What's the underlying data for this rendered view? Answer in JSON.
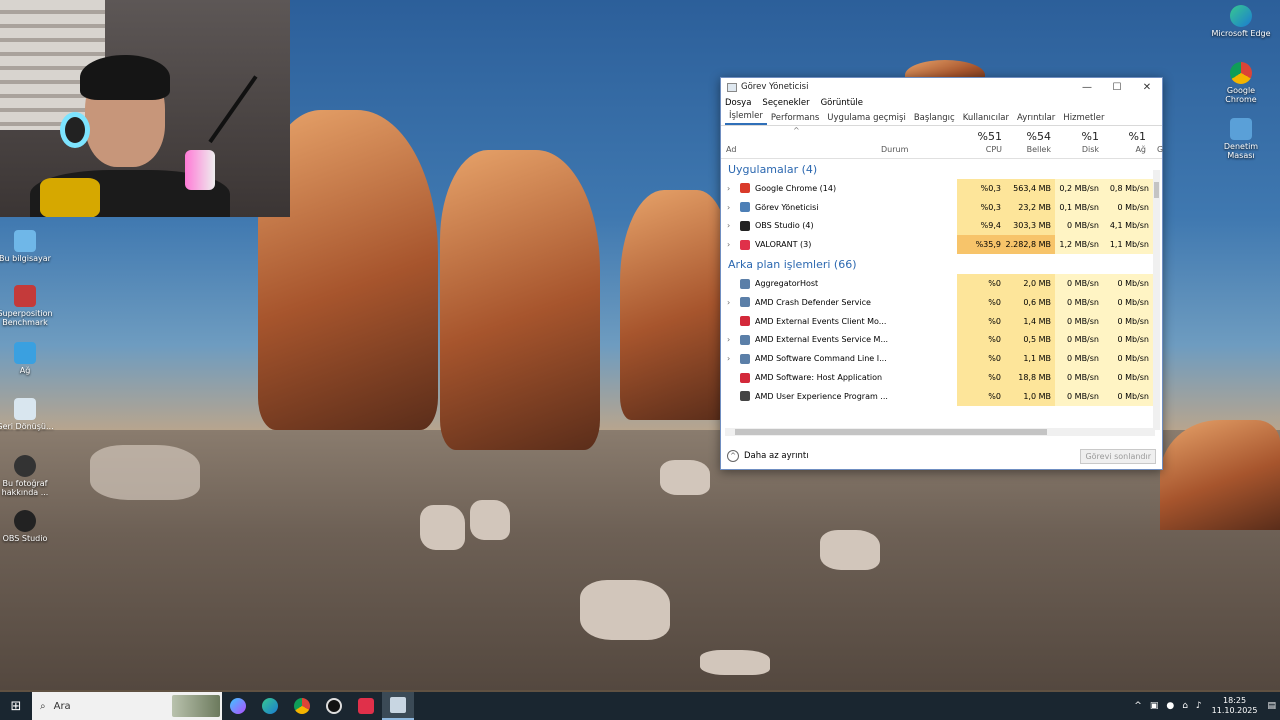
{
  "desktop_icons": [
    {
      "label": "Bu bilgisayar"
    },
    {
      "label": "Superposition Benchmark"
    },
    {
      "label": "Ağ"
    },
    {
      "label": "Geri Dönüşü..."
    },
    {
      "label": "Bu fotoğraf hakkında ..."
    },
    {
      "label": "OBS Studio"
    }
  ],
  "desktop_icons_right": [
    {
      "label": "Microsoft Edge"
    },
    {
      "label": "Google Chrome"
    },
    {
      "label": "Denetim Masası"
    }
  ],
  "window": {
    "title": "Görev Yöneticisi",
    "minimize": "—",
    "maximize": "☐",
    "close": "✕"
  },
  "menu": [
    "Dosya",
    "Seçenekler",
    "Görüntüle"
  ],
  "tabs": [
    "İşlemler",
    "Performans",
    "Uygulama geçmişi",
    "Başlangıç",
    "Kullanıcılar",
    "Ayrıntılar",
    "Hizmetler"
  ],
  "columns": {
    "name": "Ad",
    "status": "Durum",
    "cpu": {
      "pct": "%51",
      "label": "CPU"
    },
    "memory": {
      "pct": "%54",
      "label": "Bellek"
    },
    "disk": {
      "pct": "%1",
      "label": "Disk"
    },
    "network": {
      "pct": "%1",
      "label": "Ağ"
    },
    "extra": "G"
  },
  "groups": [
    {
      "title": "Uygulamalar (4)",
      "rows": [
        {
          "name": "Google Chrome (14)",
          "cpu": "%0,3",
          "mem": "563,4 MB",
          "disk": "0,2 MB/sn",
          "net": "0,8 Mb/sn",
          "icon": "#d93a2a",
          "hot": false
        },
        {
          "name": "Görev Yöneticisi",
          "cpu": "%0,3",
          "mem": "23,2 MB",
          "disk": "0,1 MB/sn",
          "net": "0 Mb/sn",
          "icon": "#4d7fb6",
          "hot": false
        },
        {
          "name": "OBS Studio (4)",
          "cpu": "%9,4",
          "mem": "303,3 MB",
          "disk": "0 MB/sn",
          "net": "4,1 Mb/sn",
          "icon": "#222222",
          "hot": false
        },
        {
          "name": "VALORANT (3)",
          "cpu": "%35,9",
          "mem": "2.282,8 MB",
          "disk": "1,2 MB/sn",
          "net": "1,1 Mb/sn",
          "icon": "#e0304a",
          "hot": true
        }
      ]
    },
    {
      "title": "Arka plan işlemleri (66)",
      "rows": [
        {
          "name": "AggregatorHost",
          "cpu": "%0",
          "mem": "2,0 MB",
          "disk": "0 MB/sn",
          "net": "0 Mb/sn",
          "icon": "#5b7fa8",
          "hot": false
        },
        {
          "name": "AMD Crash Defender Service",
          "cpu": "%0",
          "mem": "0,6 MB",
          "disk": "0 MB/sn",
          "net": "0 Mb/sn",
          "icon": "#5b7fa8",
          "hot": false
        },
        {
          "name": "AMD External Events Client Mo...",
          "cpu": "%0",
          "mem": "1,4 MB",
          "disk": "0 MB/sn",
          "net": "0 Mb/sn",
          "icon": "#d3293a",
          "hot": false
        },
        {
          "name": "AMD External Events Service M...",
          "cpu": "%0",
          "mem": "0,5 MB",
          "disk": "0 MB/sn",
          "net": "0 Mb/sn",
          "icon": "#5b7fa8",
          "hot": false
        },
        {
          "name": "AMD Software Command Line I...",
          "cpu": "%0",
          "mem": "1,1 MB",
          "disk": "0 MB/sn",
          "net": "0 Mb/sn",
          "icon": "#5b7fa8",
          "hot": false
        },
        {
          "name": "AMD Software: Host Application",
          "cpu": "%0",
          "mem": "18,8 MB",
          "disk": "0 MB/sn",
          "net": "0 Mb/sn",
          "icon": "#d3293a",
          "hot": false
        },
        {
          "name": "AMD User Experience Program ...",
          "cpu": "%0",
          "mem": "1,0 MB",
          "disk": "0 MB/sn",
          "net": "0 Mb/sn",
          "icon": "#444444",
          "hot": false
        }
      ]
    }
  ],
  "footer": {
    "less_details": "Daha az ayrıntı",
    "end_task": "Görevi sonlandır"
  },
  "taskbar": {
    "search_placeholder": "Ara",
    "time": "18:25",
    "date": "11.10.2025"
  },
  "colors": {
    "cpu_light": "#fff4c4",
    "cpu_medium": "#fde59a",
    "cpu_hot": "#f7c46a",
    "accent": "#2c68b0"
  }
}
